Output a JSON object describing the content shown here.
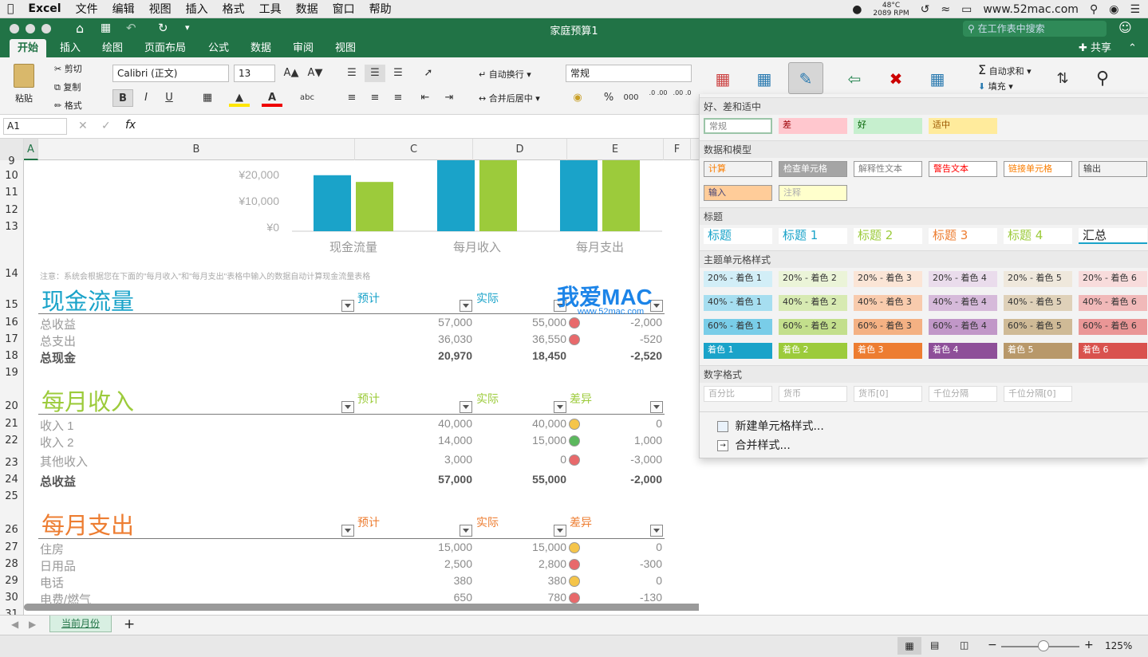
{
  "menubar": {
    "app": "Excel",
    "items": [
      "文件",
      "编辑",
      "视图",
      "插入",
      "格式",
      "工具",
      "数据",
      "窗口",
      "帮助"
    ],
    "temp": "48°C",
    "rpm": "2089 RPM",
    "site": "www.52mac.com"
  },
  "title": {
    "doc": "家庭预算1",
    "search_placeholder": "在工作表中搜索",
    "share": "共享"
  },
  "tabs": [
    "开始",
    "插入",
    "绘图",
    "页面布局",
    "公式",
    "数据",
    "审阅",
    "视图"
  ],
  "ribbon": {
    "paste": "粘贴",
    "cut": "剪切",
    "copy": "复制",
    "format": "格式",
    "font": "Calibri (正文)",
    "size": "13",
    "bold": "B",
    "italic": "I",
    "underline": "U",
    "wrap": "自动换行",
    "merge": "合并后居中",
    "numfmt": "常规",
    "percent": "%",
    "thousands": "000",
    "dec_inc": ".0 .00",
    "dec_dec": ".00 .0",
    "autosum": "自动求和",
    "fill": "填充"
  },
  "formula": {
    "namebox": "A1",
    "fx": "fx"
  },
  "columns": [
    "A",
    "B",
    "C",
    "D",
    "E",
    "F"
  ],
  "rows": [
    "9",
    "10",
    "11",
    "12",
    "13",
    "14",
    "15",
    "16",
    "17",
    "18",
    "19",
    "20",
    "21",
    "22",
    "23",
    "24",
    "25",
    "26",
    "27",
    "28",
    "29",
    "30",
    "31"
  ],
  "chart_data": {
    "type": "bar",
    "categories": [
      "现金流量",
      "每月收入",
      "每月支出"
    ],
    "yticks": [
      "¥20,000",
      "¥10,000",
      "¥0"
    ],
    "series": [
      {
        "values": [
          20970,
          57000,
          null
        ]
      },
      {
        "values": [
          18450,
          55000,
          null
        ]
      }
    ],
    "colors": [
      "#1aa3c9",
      "#9ccb3b"
    ]
  },
  "sheet": {
    "note": "注意：系统会根据您在下面的\"每月收入\"和\"每月支出\"表格中输入的数据自动计算现金流量表格",
    "cashflow": {
      "title": "现金流量",
      "h_plan": "预计",
      "h_actual": "实际",
      "rows": [
        {
          "label": "总收益",
          "plan": "57,000",
          "actual": "55,000",
          "diff": "-2,000"
        },
        {
          "label": "总支出",
          "plan": "36,030",
          "actual": "36,550",
          "diff": "-520"
        },
        {
          "label": "总现金",
          "plan": "20,970",
          "actual": "18,450",
          "diff": "-2,520"
        }
      ]
    },
    "income": {
      "title": "每月收入",
      "h_plan": "预计",
      "h_actual": "实际",
      "h_diff": "差异",
      "rows": [
        {
          "label": "收入 1",
          "plan": "40,000",
          "actual": "40,000",
          "diff": "0"
        },
        {
          "label": "收入 2",
          "plan": "14,000",
          "actual": "15,000",
          "diff": "1,000"
        },
        {
          "label": "其他收入",
          "plan": "3,000",
          "actual": "0",
          "diff": "-3,000"
        },
        {
          "label": "总收益",
          "plan": "57,000",
          "actual": "55,000",
          "diff": "-2,000"
        }
      ]
    },
    "expense": {
      "title": "每月支出",
      "h_plan": "预计",
      "h_actual": "实际",
      "h_diff": "差异",
      "rows": [
        {
          "label": "住房",
          "plan": "15,000",
          "actual": "15,000",
          "diff": "0"
        },
        {
          "label": "日用品",
          "plan": "2,500",
          "actual": "2,800",
          "diff": "-300"
        },
        {
          "label": "电话",
          "plan": "380",
          "actual": "380",
          "diff": "0"
        },
        {
          "label": "电费/燃气",
          "plan": "650",
          "actual": "780",
          "diff": "-130"
        }
      ]
    }
  },
  "watermark": {
    "brand": "我爱MAC",
    "url": "www.52mac.com"
  },
  "styles_panel": {
    "sec1": "好、差和适中",
    "good_bad": [
      {
        "t": "常规",
        "bg": "#ffffff",
        "c": "#888888"
      },
      {
        "t": "差",
        "bg": "#ffc7ce",
        "c": "#9c0006"
      },
      {
        "t": "好",
        "bg": "#c6efce",
        "c": "#006100"
      },
      {
        "t": "适中",
        "bg": "#ffeb9c",
        "c": "#9c5700"
      }
    ],
    "sec2": "数据和模型",
    "data_model": [
      {
        "t": "计算",
        "bg": "#f2f2f2",
        "c": "#fa7d00"
      },
      {
        "t": "检查单元格",
        "bg": "#a5a5a5",
        "c": "#ffffff"
      },
      {
        "t": "解释性文本",
        "bg": "#ffffff",
        "c": "#7f7f7f"
      },
      {
        "t": "警告文本",
        "bg": "#ffffff",
        "c": "#ff0000"
      },
      {
        "t": "链接单元格",
        "bg": "#ffffff",
        "c": "#fa7d00"
      },
      {
        "t": "输出",
        "bg": "#f2f2f2",
        "c": "#3f3f3f"
      },
      {
        "t": "输入",
        "bg": "#ffcc99",
        "c": "#3f3f76"
      },
      {
        "t": "注释",
        "bg": "#ffffcc",
        "c": "#b0b0b0"
      }
    ],
    "sec3": "标题",
    "titles": [
      {
        "t": "标题",
        "c": "#1aa3c9"
      },
      {
        "t": "标题 1",
        "c": "#1aa3c9"
      },
      {
        "t": "标题 2",
        "c": "#9ccb3b"
      },
      {
        "t": "标题 3",
        "c": "#ed7d31"
      },
      {
        "t": "标题 4",
        "c": "#9ccb3b"
      },
      {
        "t": "汇总",
        "c": "#222222"
      }
    ],
    "sec4": "主题单元格样式",
    "theme20": [
      {
        "t": "20% - 着色 1",
        "bg": "#d2eef7"
      },
      {
        "t": "20% - 着色 2",
        "bg": "#ebf4d8"
      },
      {
        "t": "20% - 着色 3",
        "bg": "#fbe5d6"
      },
      {
        "t": "20% - 着色 4",
        "bg": "#eadcec"
      },
      {
        "t": "20% - 着色 5",
        "bg": "#efe8dc"
      },
      {
        "t": "20% - 着色 6",
        "bg": "#f8dcdc"
      }
    ],
    "theme40": [
      {
        "t": "40% - 着色 1",
        "bg": "#a6def0"
      },
      {
        "t": "40% - 着色 2",
        "bg": "#d7eab2"
      },
      {
        "t": "40% - 着色 3",
        "bg": "#f8cbad"
      },
      {
        "t": "40% - 着色 4",
        "bg": "#d6bada"
      },
      {
        "t": "40% - 着色 5",
        "bg": "#dfd1b9"
      },
      {
        "t": "40% - 着色 6",
        "bg": "#f1b9b9"
      }
    ],
    "theme60": [
      {
        "t": "60% - 着色 1",
        "bg": "#79cde8"
      },
      {
        "t": "60% - 着色 2",
        "bg": "#c3df8c"
      },
      {
        "t": "60% - 着色 3",
        "bg": "#f4b183"
      },
      {
        "t": "60% - 着色 4",
        "bg": "#c197c8"
      },
      {
        "t": "60% - 着色 5",
        "bg": "#cfba96"
      },
      {
        "t": "60% - 着色 6",
        "bg": "#ea9696"
      }
    ],
    "theme100": [
      {
        "t": "着色 1",
        "bg": "#1aa3c9"
      },
      {
        "t": "着色 2",
        "bg": "#9ccb3b"
      },
      {
        "t": "着色 3",
        "bg": "#ed7d31"
      },
      {
        "t": "着色 4",
        "bg": "#8e4f99"
      },
      {
        "t": "着色 5",
        "bg": "#b8986a"
      },
      {
        "t": "着色 6",
        "bg": "#d9524e"
      }
    ],
    "sec5": "数字格式",
    "numfmt": [
      "百分比",
      "货币",
      "货币[0]",
      "千位分隔",
      "千位分隔[0]"
    ],
    "new_style": "新建单元格样式...",
    "merge_style": "合并样式..."
  },
  "sheet_tabs": {
    "current": "当前月份",
    "add": "+"
  },
  "status": {
    "zoom": "125%"
  }
}
